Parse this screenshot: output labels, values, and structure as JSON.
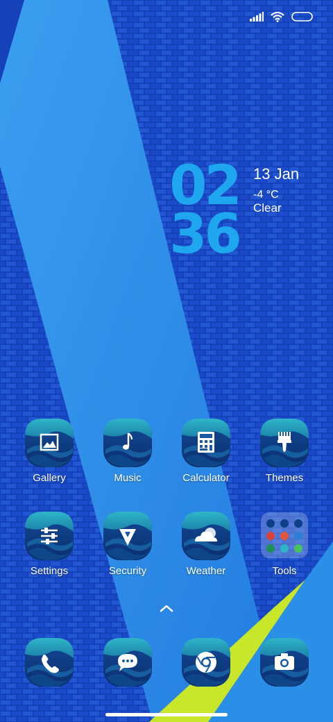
{
  "status_bar": {
    "signal_icon": "signal-bars-icon",
    "wifi_icon": "wifi-icon",
    "battery_icon": "battery-icon"
  },
  "clock": {
    "hour": "02",
    "minute": "36",
    "date": "13 Jan",
    "temperature": "-4 °C",
    "condition": "Clear"
  },
  "apps_row1": [
    {
      "label": "Gallery",
      "icon": "gallery-icon"
    },
    {
      "label": "Music",
      "icon": "music-note-icon"
    },
    {
      "label": "Calculator",
      "icon": "calculator-icon"
    },
    {
      "label": "Themes",
      "icon": "paintbrush-icon"
    }
  ],
  "apps_row2": [
    {
      "label": "Settings",
      "icon": "sliders-icon"
    },
    {
      "label": "Security",
      "icon": "shield-icon"
    },
    {
      "label": "Weather",
      "icon": "cloud-sun-icon"
    },
    {
      "label": "Tools",
      "icon": "folder-icon"
    }
  ],
  "dock": [
    {
      "icon": "phone-icon"
    },
    {
      "icon": "messages-icon"
    },
    {
      "icon": "chrome-icon"
    },
    {
      "icon": "camera-icon"
    }
  ],
  "colors": {
    "wallpaper_dark": "#1747c4",
    "stripe_blue": "#2d8fe6",
    "accent_lime": "#c8e62a",
    "clock_blue": "#1ea6ee"
  }
}
